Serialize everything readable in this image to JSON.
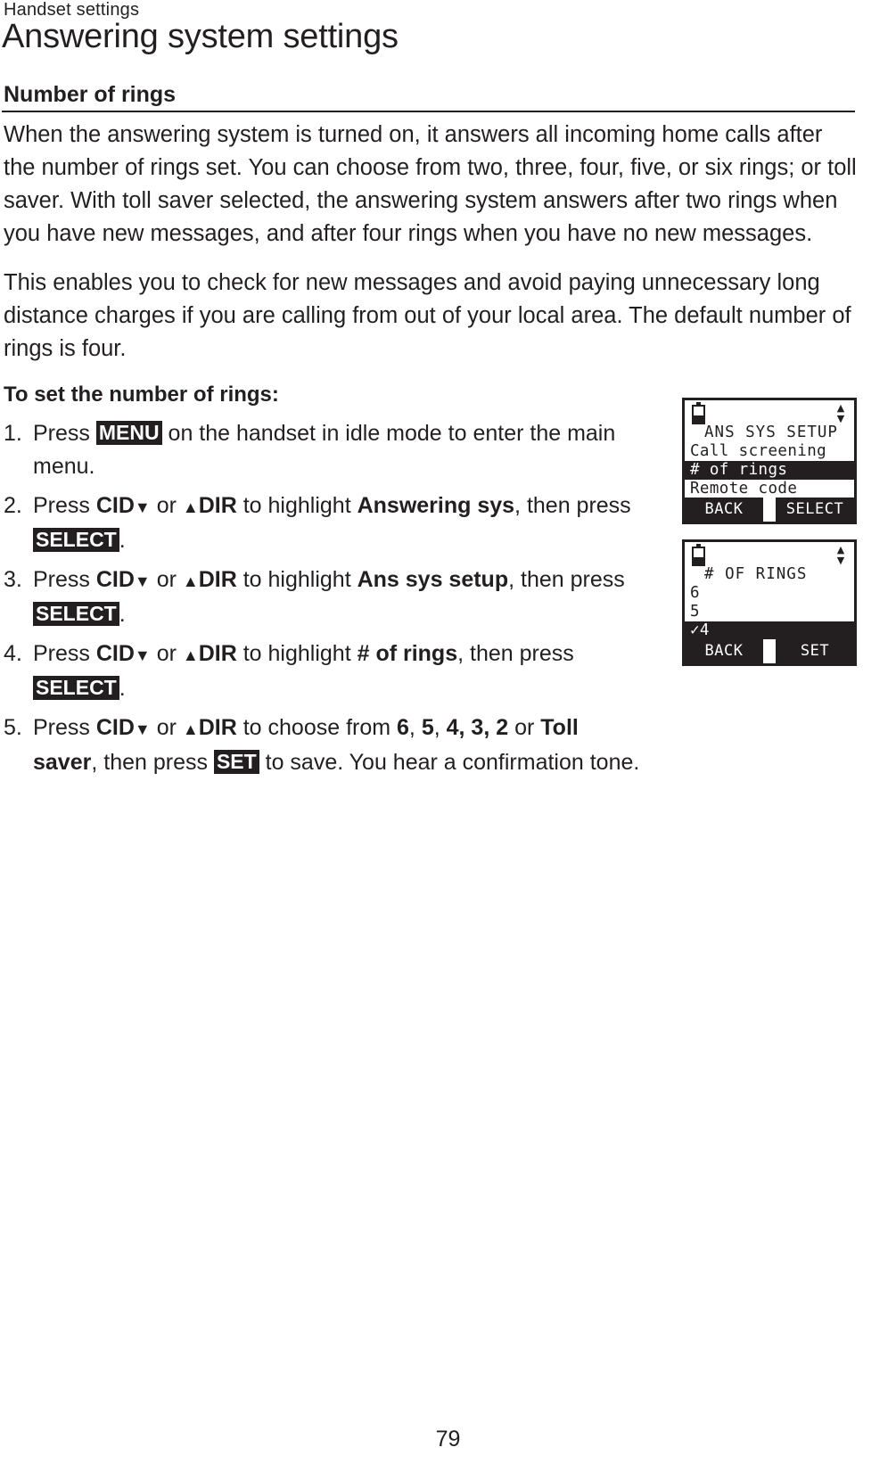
{
  "header": {
    "running_head": "Handset settings",
    "chapter_title": "Answering system settings"
  },
  "section": {
    "heading": "Number of rings",
    "paragraphs": [
      "When the answering system is turned on, it answers all incoming home calls after the number of rings set. You can choose from two, three, four, five, or six rings; or toll saver. With toll saver selected, the answering system answers after two rings when you have new messages, and after four rings when you have no new messages.",
      "This enables you to check for new messages and avoid paying unnecessary long distance charges if you are calling from out of your local area. The default number of rings is four."
    ],
    "lead_in": "To set the number of rings:"
  },
  "steps": [
    {
      "num": "1.",
      "parts": [
        {
          "t": "text",
          "v": "Press "
        },
        {
          "t": "key",
          "v": "MENU"
        },
        {
          "t": "text",
          "v": " on the handset in idle mode to enter the main menu."
        }
      ]
    },
    {
      "num": "2.",
      "parts": [
        {
          "t": "text",
          "v": "Press "
        },
        {
          "t": "bold-down",
          "v": "CID"
        },
        {
          "t": "text",
          "v": " or "
        },
        {
          "t": "bold-up",
          "v": "DIR"
        },
        {
          "t": "text",
          "v": " to highlight "
        },
        {
          "t": "bold",
          "v": "Answering sys"
        },
        {
          "t": "text",
          "v": ", then press "
        },
        {
          "t": "key",
          "v": "SELECT"
        },
        {
          "t": "text",
          "v": "."
        }
      ]
    },
    {
      "num": "3.",
      "parts": [
        {
          "t": "text",
          "v": "Press "
        },
        {
          "t": "bold-down",
          "v": "CID"
        },
        {
          "t": "text",
          "v": " or "
        },
        {
          "t": "bold-up",
          "v": "DIR"
        },
        {
          "t": "text",
          "v": " to highlight "
        },
        {
          "t": "bold",
          "v": "Ans sys setup"
        },
        {
          "t": "text",
          "v": ", then press "
        },
        {
          "t": "key",
          "v": "SELECT"
        },
        {
          "t": "text",
          "v": "."
        }
      ]
    },
    {
      "num": "4.",
      "parts": [
        {
          "t": "text",
          "v": "Press "
        },
        {
          "t": "bold-down",
          "v": "CID"
        },
        {
          "t": "text",
          "v": " or "
        },
        {
          "t": "bold-up",
          "v": "DIR"
        },
        {
          "t": "text",
          "v": " to highlight "
        },
        {
          "t": "bold",
          "v": "# of rings"
        },
        {
          "t": "text",
          "v": ", then press "
        },
        {
          "t": "key",
          "v": "SELECT"
        },
        {
          "t": "text",
          "v": "."
        }
      ]
    },
    {
      "num": "5.",
      "parts": [
        {
          "t": "text",
          "v": "Press "
        },
        {
          "t": "bold-down",
          "v": "CID"
        },
        {
          "t": "text",
          "v": " or "
        },
        {
          "t": "bold-up",
          "v": "DIR"
        },
        {
          "t": "text",
          "v": " to choose from "
        },
        {
          "t": "bold",
          "v": "6"
        },
        {
          "t": "text",
          "v": ", "
        },
        {
          "t": "bold",
          "v": "5"
        },
        {
          "t": "text",
          "v": ", "
        },
        {
          "t": "bold",
          "v": "4, 3, 2"
        },
        {
          "t": "text",
          "v": " or "
        },
        {
          "t": "bold",
          "v": "Toll saver"
        },
        {
          "t": "text",
          "v": ", then press "
        },
        {
          "t": "key",
          "v": "SET"
        },
        {
          "t": "text",
          "v": " to save. You hear a confirmation tone."
        }
      ]
    }
  ],
  "lcd_screens": [
    {
      "id": "ans-sys-setup",
      "title": "ANS SYS SETUP",
      "items": [
        {
          "label": "Call screening",
          "selected": false
        },
        {
          "label": "# of rings",
          "selected": true
        },
        {
          "label": "Remote code",
          "selected": false
        }
      ],
      "softkeys": {
        "left": "BACK",
        "right": "SELECT"
      },
      "battery_icon": "battery-icon",
      "scroll_icon": "up-down-arrows-icon"
    },
    {
      "id": "number-of-rings",
      "title": "# OF RINGS",
      "items": [
        {
          "label": "6",
          "selected": false
        },
        {
          "label": "5",
          "selected": false
        },
        {
          "label": "✓4",
          "selected": true
        }
      ],
      "softkeys": {
        "left": "BACK",
        "right": "SET"
      },
      "battery_icon": "battery-icon",
      "scroll_icon": "up-down-arrows-icon"
    }
  ],
  "footer": {
    "page_number": "79"
  },
  "colors": {
    "ink": "#231f20",
    "paper": "#ffffff"
  }
}
